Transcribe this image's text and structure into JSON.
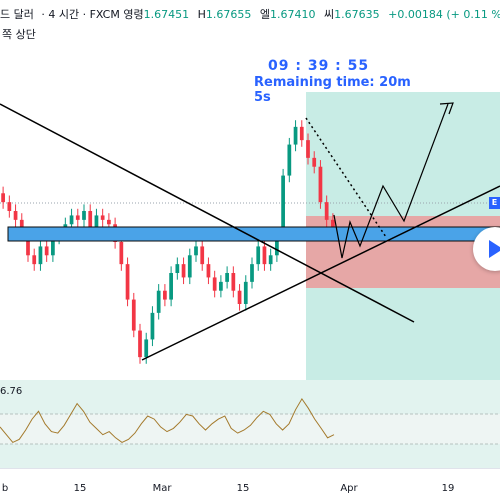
{
  "header": {
    "symbol_name": "드 달러",
    "interval": "4 시간",
    "source": "FXCM",
    "ohlc": [
      {
        "key": "영령",
        "value": "1.67451"
      },
      {
        "key": "H",
        "value": "1.67655"
      },
      {
        "key": "엘",
        "value": "1.67410"
      },
      {
        "key": "씨",
        "value": "1.67635"
      }
    ],
    "change": "+0.00184 (+ 0.11 %)",
    "sub_label": "쪽 상단"
  },
  "timer": {
    "clock": "09 : 39 : 55",
    "remaining": "Remaining time: 20m 5s"
  },
  "oscillator": {
    "value_label": "6.76"
  },
  "price_tag": "E",
  "colors": {
    "up": "#089981",
    "down": "#f23645",
    "trendline": "#000000",
    "zone_blue": "#4aa3e8",
    "zone_green": "#c8ece5",
    "zone_red": "#e6a7a6",
    "oscillator": "#a47a2c"
  },
  "chart_data": {
    "type": "candlestick",
    "x_tick_labels": [
      "b",
      "15",
      "Mar",
      "15",
      "Apr",
      "19"
    ],
    "candles_approx_close": [
      1.662,
      1.66,
      1.658,
      1.655,
      1.65,
      1.648,
      1.652,
      1.65,
      1.654,
      1.655,
      1.657,
      1.659,
      1.658,
      1.66,
      1.656,
      1.659,
      1.658,
      1.657,
      1.653,
      1.648,
      1.64,
      1.633,
      1.627,
      1.631,
      1.637,
      1.642,
      1.64,
      1.646,
      1.648,
      1.645,
      1.65,
      1.652,
      1.648,
      1.645,
      1.642,
      1.644,
      1.646,
      1.642,
      1.639,
      1.644,
      1.648,
      1.652,
      1.648,
      1.65,
      1.655,
      1.668,
      1.675,
      1.679,
      1.676,
      1.672,
      1.67,
      1.662,
      1.658,
      1.6555
    ],
    "oscillator_values": [
      50,
      45,
      40,
      42,
      48,
      55,
      60,
      52,
      47,
      46,
      51,
      58,
      65,
      60,
      53,
      49,
      45,
      47,
      43,
      40,
      42,
      46,
      52,
      57,
      55,
      50,
      47,
      49,
      53,
      58,
      57,
      52,
      48,
      52,
      55,
      57,
      49,
      46,
      48,
      51,
      56,
      60,
      58,
      52,
      48,
      52,
      61,
      68,
      62,
      55,
      49,
      43,
      45
    ]
  }
}
